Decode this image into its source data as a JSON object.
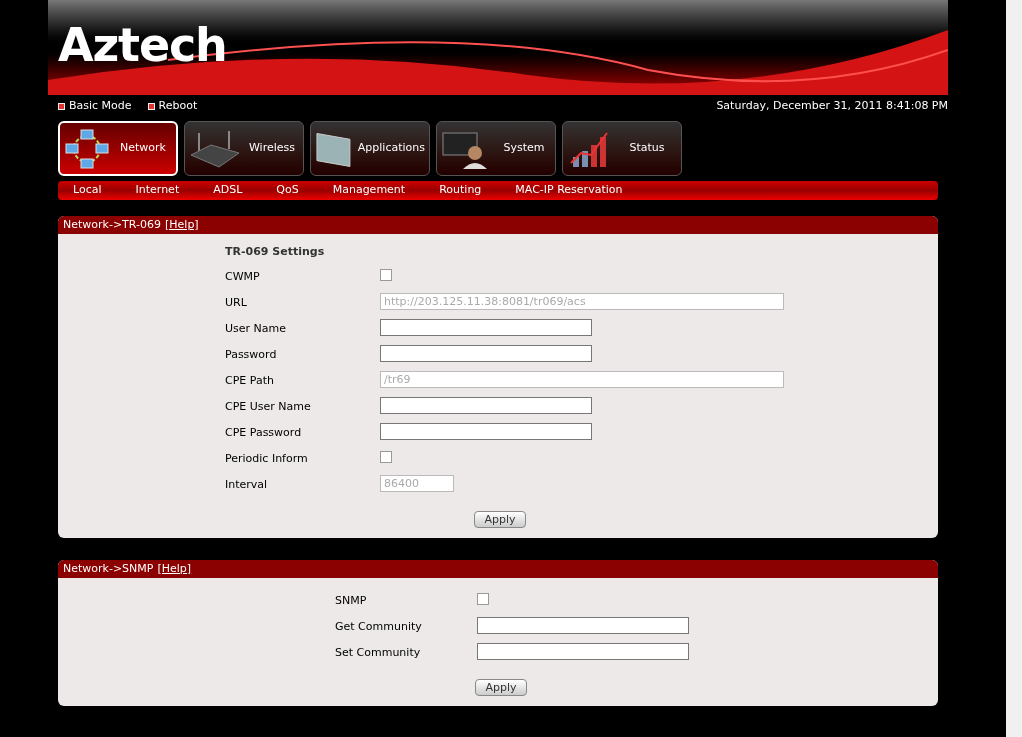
{
  "header": {
    "logo": "Aztech",
    "links": [
      "Basic Mode",
      "Reboot"
    ],
    "datetime": "Saturday, December 31, 2011 8:41:08 PM"
  },
  "main_tabs": [
    {
      "label": "Network",
      "selected": true
    },
    {
      "label": "Wireless",
      "selected": false
    },
    {
      "label": "Applications",
      "selected": false
    },
    {
      "label": "System",
      "selected": false
    },
    {
      "label": "Status",
      "selected": false
    }
  ],
  "sub_tabs": [
    "Local",
    "Internet",
    "ADSL",
    "QoS",
    "Management",
    "Routing",
    "MAC-IP Reservation"
  ],
  "panels": [
    {
      "title": "Network->TR-069",
      "help": "[Help]",
      "heading": "TR-069 Settings",
      "button": "Apply",
      "fields": [
        {
          "kind": "checkbox",
          "label": "CWMP",
          "checked": false
        },
        {
          "kind": "longtext",
          "label": "URL",
          "value": "http://203.125.11.38:8081/tr069/acs",
          "disabled": true
        },
        {
          "kind": "text",
          "label": "User Name",
          "disabled": false
        },
        {
          "kind": "text",
          "label": "Password",
          "disabled": false
        },
        {
          "kind": "longtext",
          "label": "CPE Path",
          "value": "/tr69",
          "disabled": true
        },
        {
          "kind": "text",
          "label": "CPE User Name",
          "disabled": false
        },
        {
          "kind": "text",
          "label": "CPE Password",
          "disabled": false
        },
        {
          "kind": "checkbox",
          "label": "Periodic Inform",
          "checked": false
        },
        {
          "kind": "number",
          "label": "Interval",
          "value": "86400",
          "disabled": true
        }
      ]
    },
    {
      "title": "Network->SNMP",
      "help": "[Help]",
      "button": "Apply",
      "fields": [
        {
          "kind": "checkbox",
          "label": "SNMP",
          "checked": false
        },
        {
          "kind": "text",
          "label": "Get Community",
          "disabled": false
        },
        {
          "kind": "text",
          "label": "Set Community",
          "disabled": false
        }
      ]
    }
  ]
}
